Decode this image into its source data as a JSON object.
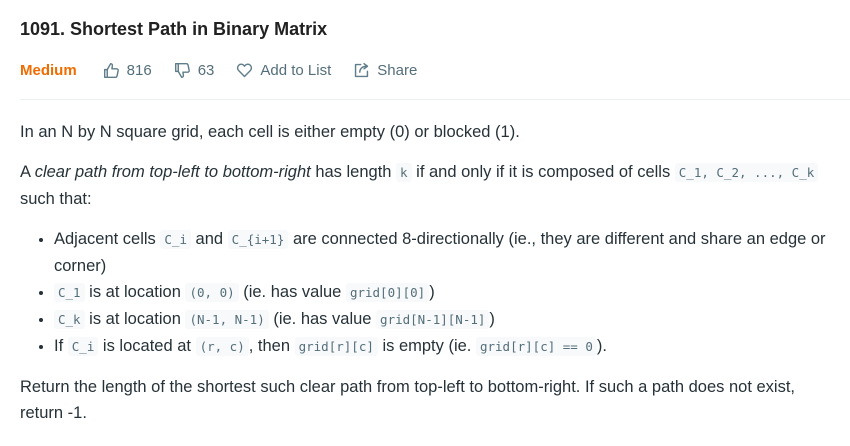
{
  "problem": {
    "title": "1091. Shortest Path in Binary Matrix",
    "difficulty": "Medium",
    "likes": "816",
    "dislikes": "63",
    "add_to_list": "Add to List",
    "share": "Share"
  },
  "colors": {
    "difficulty": "#ef6c00",
    "text": "#263238",
    "meta": "#546e7a"
  },
  "icons": [
    "thumbs-up-icon",
    "thumbs-down-icon",
    "heart-icon",
    "share-icon"
  ],
  "description": {
    "p1": "In an N by N square grid, each cell is either empty (0) or blocked (1).",
    "p2_a": "A ",
    "p2_em": "clear path from top-left to bottom-right",
    "p2_b": " has length ",
    "p2_code_k": "k",
    "p2_c": " if and only if it is composed of cells ",
    "p2_code_cells": "C_1, C_2, ..., C_k",
    "p2_d": " such that:",
    "b1_a": "Adjacent cells ",
    "b1_code1": "C_i",
    "b1_b": " and ",
    "b1_code2": "C_{i+1}",
    "b1_c": " are connected 8-directionally (ie., they are different and share an edge or corner)",
    "b2_code1": "C_1",
    "b2_a": " is at location ",
    "b2_code2": "(0, 0)",
    "b2_b": " (ie. has value ",
    "b2_code3": "grid[0][0]",
    "b2_c": ")",
    "b3_code1": "C_k",
    "b3_a": " is at location ",
    "b3_code2": "(N-1, N-1)",
    "b3_b": " (ie. has value ",
    "b3_code3": "grid[N-1][N-1]",
    "b3_c": ")",
    "b4_a": "If ",
    "b4_code1": "C_i",
    "b4_b": " is located at ",
    "b4_code2": "(r, c)",
    "b4_c": ", then ",
    "b4_code3": "grid[r][c]",
    "b4_d": " is empty (ie. ",
    "b4_code4": "grid[r][c] == 0",
    "b4_e": ").",
    "p3": "Return the length of the shortest such clear path from top-left to bottom-right.  If such a path does not exist, return -1."
  }
}
